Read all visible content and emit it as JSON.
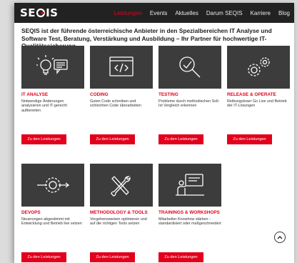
{
  "brand": {
    "logo_text_start": "SE",
    "logo_text_end": "IS"
  },
  "nav": {
    "items": [
      {
        "label": "Leistungen",
        "active": true
      },
      {
        "label": "Events"
      },
      {
        "label": "Aktuelles"
      },
      {
        "label": "Darum SEQIS"
      },
      {
        "label": "Karriere"
      },
      {
        "label": "Blog"
      }
    ]
  },
  "intro": "SEQIS ist der führende österreichische Anbieter in den Spezialbereichen IT Analyse und Software Test, Beratung, Verstärkung und Ausbildung – Ihr Partner für hochwertige IT-Qualitätssicherung.",
  "services": [
    {
      "title": "IT ANALYSE",
      "desc": "Notwendige Änderungen analysieren und IT-gerecht aufbereiten",
      "icon": "lightbulb-chat-icon",
      "button": "Zu den Leistungen"
    },
    {
      "title": "CODING",
      "desc": "Guten Code schreiben und schlechten Code überarbeiten",
      "icon": "code-window-icon",
      "button": "Zu den Leistungen"
    },
    {
      "title": "TESTING",
      "desc": "Probleme durch methodischen Soll-Ist Vergleich erkennen",
      "icon": "magnifier-icon",
      "button": "Zu den Leistungen"
    },
    {
      "title": "RELEASE & OPERATE",
      "desc": "Reibungsloser Go Live und Betrieb der IT-Lösungen",
      "icon": "gears-icon",
      "button": "Zu den Leistungen"
    },
    {
      "title": "DEVOPS",
      "desc": "Neuerungen abgestimmt mit Entwicklung und Betrieb live setzen",
      "icon": "gear-pipeline-icon",
      "button": "Zu den Leistungen"
    },
    {
      "title": "METHODOLOGY & TOOLS",
      "desc": "Vorgehensweisen optimieren und auf die richtigen Tools setzen",
      "icon": "tools-icon",
      "button": "Zu den Leistungen"
    },
    {
      "title": "TRAININGS & WORKSHOPS",
      "desc": "Mitarbeiter Knowhow stärken - standardisiert oder maßgeschneidert",
      "icon": "presenter-icon",
      "button": "Zu den Leistungen"
    }
  ],
  "colors": {
    "accent": "#e2001a",
    "topbar": "#222222",
    "tile": "#3c3c3c"
  }
}
